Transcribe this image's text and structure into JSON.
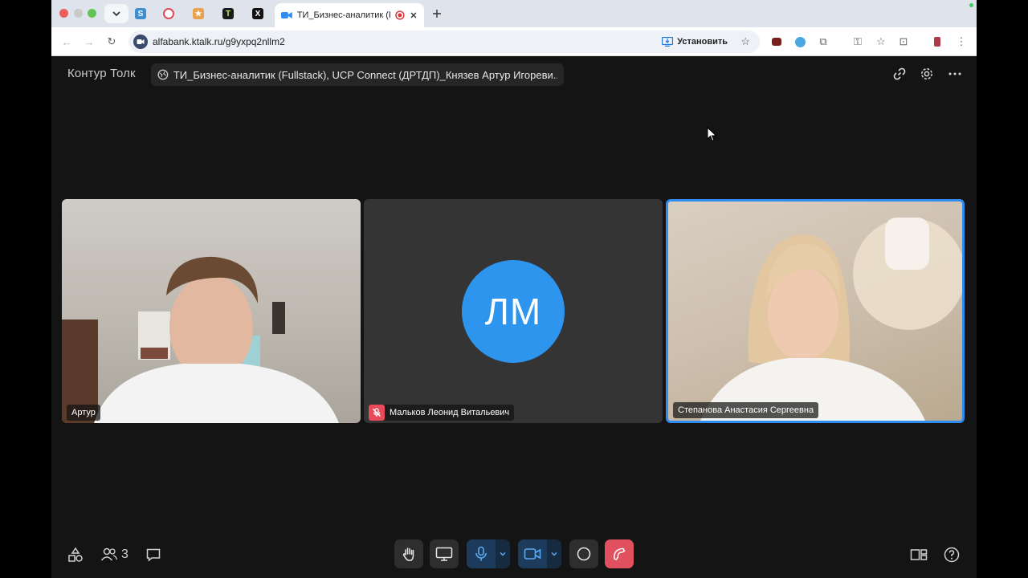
{
  "browser": {
    "active_tab": {
      "title": "ТИ_Бизнес-аналитик (Fu"
    },
    "url": "alfabank.ktalk.ru/g9yxpq2nllm2",
    "install_label": "Установить"
  },
  "app": {
    "brand": "Контур Толк",
    "room_title": "ТИ_Бизнес-аналитик (Fullstack), UCP Connect (ДРТДП)_Князев Артур Игореви..."
  },
  "participants": [
    {
      "name": "Артур",
      "video": true,
      "muted": false
    },
    {
      "name": "Мальков Леонид Витальевич",
      "initials": "ЛМ",
      "video": false,
      "muted": true
    },
    {
      "name": "Степанова Анастасия Сергеевна",
      "video": true,
      "muted": false,
      "speaking": true
    }
  ],
  "bottombar": {
    "participant_count": "3"
  },
  "colors": {
    "accent": "#2f8cf1",
    "hangup": "#e0505f",
    "avatar": "#2e95ee"
  }
}
